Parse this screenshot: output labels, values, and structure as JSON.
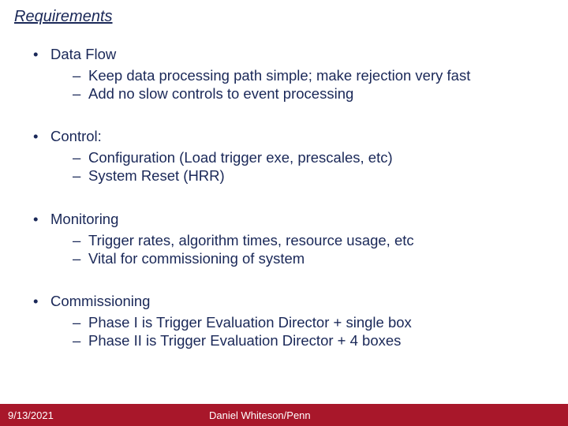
{
  "title": "Requirements",
  "sections": [
    {
      "head": "Data Flow",
      "subs": [
        "Keep data processing path simple; make rejection very fast",
        "Add no slow controls to event processing"
      ]
    },
    {
      "head": "Control:",
      "subs": [
        "Configuration (Load trigger exe, prescales, etc)",
        "System Reset (HRR)"
      ]
    },
    {
      "head": "Monitoring",
      "subs": [
        "Trigger rates, algorithm times, resource usage, etc",
        "Vital for commissioning of system"
      ]
    },
    {
      "head": "Commissioning",
      "subs": [
        "Phase I is Trigger Evaluation Director + single box",
        "Phase II is Trigger Evaluation Director + 4 boxes"
      ]
    }
  ],
  "footer": {
    "date": "9/13/2021",
    "author": "Daniel Whiteson/Penn"
  }
}
